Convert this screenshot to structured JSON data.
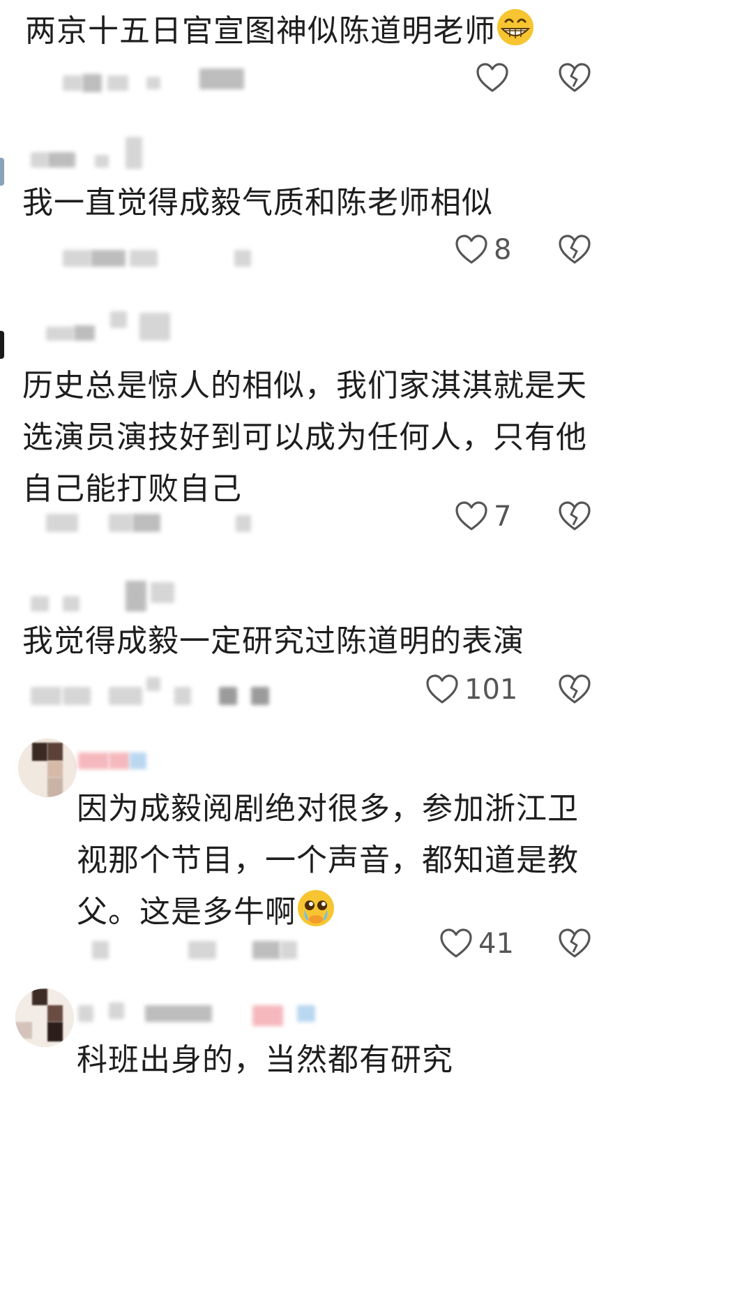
{
  "comments": [
    {
      "text": "两京十五日官宣图神似陈道明老师",
      "emoji": "grinning-face-emoji",
      "likes": ""
    },
    {
      "text": "我一直觉得成毅气质和陈老师相似",
      "likes": "8"
    },
    {
      "text_lines": [
        "历史总是惊人的相似，我们家淇淇就是天",
        "选演员演技好到可以成为任何人，只有他",
        "自己能打败自己"
      ],
      "likes": "7"
    },
    {
      "text": "我觉得成毅一定研究过陈道明的表演",
      "likes": "101"
    },
    {
      "text_lines": [
        "因为成毅阅剧绝对很多，参加浙江卫",
        "视那个节目，一个声音，都知道是教",
        "父。这是多牛啊"
      ],
      "emoji": "pleading-face-emoji",
      "likes": "41"
    },
    {
      "text": "科班出身的，当然都有研究",
      "likes": ""
    }
  ],
  "icons": {
    "like": "heart-outline-icon",
    "dislike": "broken-heart-icon"
  },
  "colors": {
    "text": "#1e1e1e",
    "icon": "#555555",
    "emoji": "#f7c531"
  }
}
